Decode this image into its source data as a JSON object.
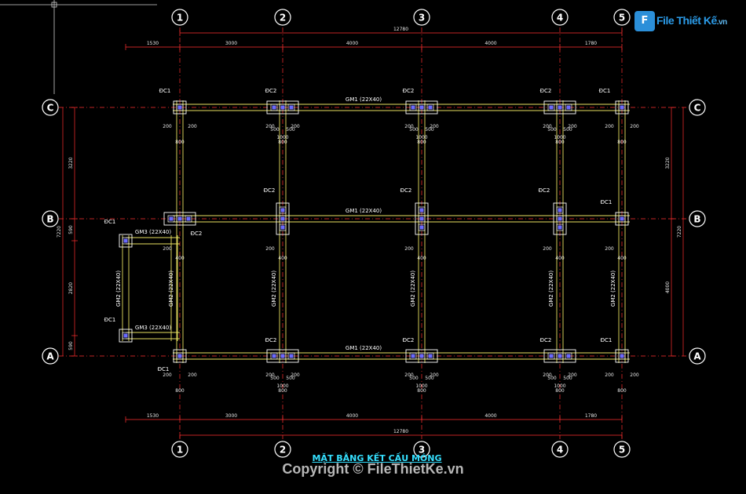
{
  "drawing": {
    "title": "MẶT BẰNG KẾT CẤU MÓNG",
    "copyright": "Copyright © FileThietKe.vn",
    "logo_text": "File Thiết Kế",
    "logo_suffix": ".vn",
    "logo_mark": "F"
  },
  "colors": {
    "background": "#000000",
    "grid": "#ff3030",
    "beam": "#e8e060",
    "column": "#ffffff",
    "pile": "#6a6aff",
    "title": "#35e0ff"
  },
  "axes": {
    "columns": [
      "1",
      "2",
      "3",
      "4",
      "5"
    ],
    "rows": [
      "C",
      "B",
      "A"
    ]
  },
  "dimensions": {
    "top_total": "12780",
    "top_segments": [
      "1530",
      "3000",
      "4000",
      "4000",
      "1780"
    ],
    "bottom_total": "12780",
    "bottom_segments": [
      "1530",
      "3000",
      "4000",
      "4000",
      "1780"
    ],
    "left_total": "7220",
    "left_segments": [
      "3220",
      "590",
      "2820",
      "590"
    ],
    "right_total": "7220",
    "right_segments": [
      "3220",
      "4000"
    ]
  },
  "labels": {
    "dc1": "ĐC1",
    "dc2": "ĐC2",
    "gm1": "GM1 (22X40)",
    "gm2": "GM2 (22X40)",
    "gm3": "GM3 (22X40)",
    "d200": "200",
    "d400": "400",
    "d500": "500",
    "d800": "800",
    "d1000": "1000"
  }
}
